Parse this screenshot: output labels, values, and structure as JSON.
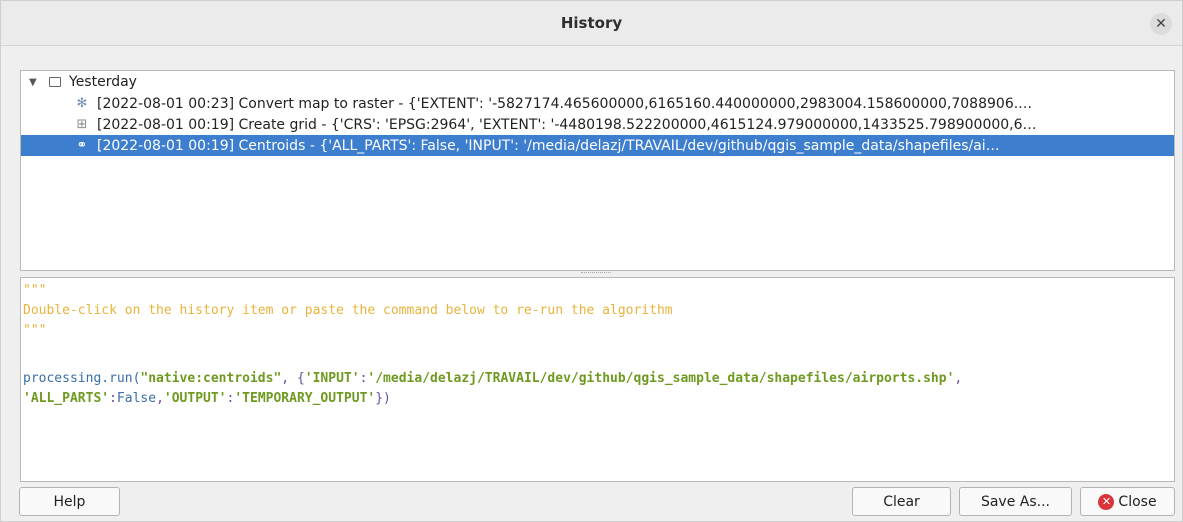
{
  "window": {
    "title": "History"
  },
  "tree": {
    "group": {
      "label": "Yesterday"
    },
    "items": [
      {
        "icon": "gear-icon",
        "text": "[2022-08-01 00:23] Convert map to raster - {'EXTENT': '-5827174.465600000,6165160.440000000,2983004.158600000,7088906.…"
      },
      {
        "icon": "grid-icon",
        "text": "[2022-08-01 00:19] Create grid - {'CRS': 'EPSG:2964', 'EXTENT': '-4480198.522200000,4615124.979000000,1433525.798900000,6…"
      },
      {
        "icon": "centroids-icon",
        "text": "[2022-08-01 00:19] Centroids - {'ALL_PARTS': False, 'INPUT': '/media/delazj/TRAVAIL/dev/github/qgis_sample_data/shapefiles/ai…",
        "selected": true
      }
    ]
  },
  "editor": {
    "quote1": "\"\"\"",
    "comment": "Double-click on the history item or paste the command below to re-run the algorithm",
    "quote2": "\"\"\"",
    "cmd_prefix": "processing.run(",
    "cmd_alg": "\"native:centroids\"",
    "cmd_sep": ", {",
    "cmd_k1": "'INPUT'",
    "cmd_colon1": ":",
    "cmd_v1": "'/media/delazj/TRAVAIL/dev/github/qgis_sample_data/shapefiles/airports.shp'",
    "cmd_comma1": ",",
    "cmd_k2": "'ALL_PARTS'",
    "cmd_colon2": ":",
    "cmd_v2": "False",
    "cmd_comma2": ",",
    "cmd_k3": "'OUTPUT'",
    "cmd_colon3": ":",
    "cmd_v3": "'TEMPORARY_OUTPUT'",
    "cmd_end": "})"
  },
  "buttons": {
    "help": "Help",
    "clear": "Clear",
    "save_as": "Save As...",
    "close": "Close"
  },
  "colors": {
    "selection": "#3d7ecf",
    "comment": "#e8b33a",
    "string": "#6e9a1f",
    "close_icon": "#d8343a"
  }
}
